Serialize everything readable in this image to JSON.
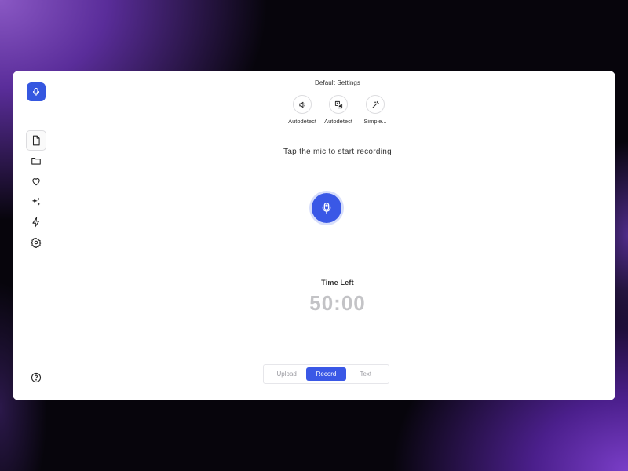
{
  "header": {
    "title": "Default Settings"
  },
  "options": [
    {
      "label": "Autodetect",
      "icon": "speaker-icon"
    },
    {
      "label": "Autodetect",
      "icon": "translate-icon"
    },
    {
      "label": "Simple...",
      "icon": "magic-wand-icon"
    }
  ],
  "recorder": {
    "prompt": "Tap the mic to start recording",
    "time_label": "Time Left",
    "time_value": "50:00"
  },
  "modes": [
    {
      "label": "Upload",
      "active": false
    },
    {
      "label": "Record",
      "active": true
    },
    {
      "label": "Text",
      "active": false
    }
  ],
  "sidebar": {
    "items": [
      {
        "icon": "document-icon",
        "active": true
      },
      {
        "icon": "folder-icon",
        "active": false
      },
      {
        "icon": "heart-icon",
        "active": false
      },
      {
        "icon": "sparkle-icon",
        "active": false
      },
      {
        "icon": "lightning-icon",
        "active": false
      },
      {
        "icon": "gear-icon",
        "active": false
      }
    ],
    "help_icon": "help-icon"
  },
  "colors": {
    "accent": "#3a58e6",
    "accent_soft": "#d7defb",
    "muted_text": "#c3c3c6"
  }
}
